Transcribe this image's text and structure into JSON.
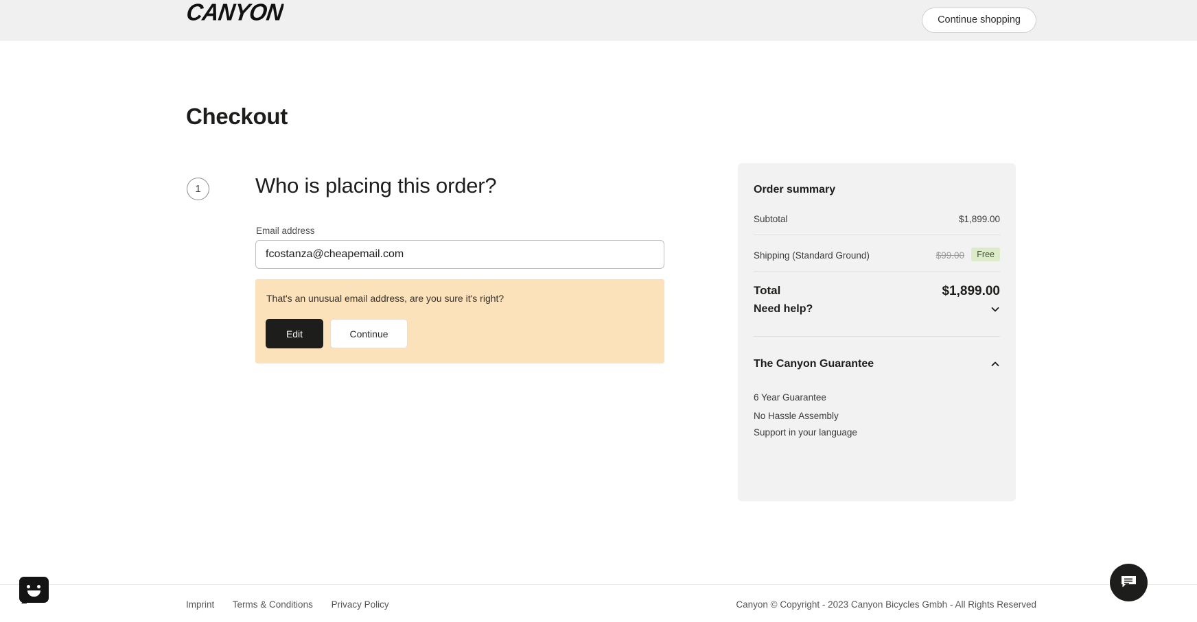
{
  "header": {
    "logo_text": "CANYON",
    "continue_shopping_label": "Continue shopping"
  },
  "page": {
    "title": "Checkout"
  },
  "step": {
    "number": "1",
    "heading": "Who is placing this order?"
  },
  "form": {
    "email_label": "Email address",
    "email_value": "fcostanza@cheapemail.com",
    "email_placeholder": "Email address"
  },
  "warning": {
    "message": "That's an unusual email address, are you sure it's right?",
    "edit_label": "Edit",
    "continue_label": "Continue",
    "background_color": "#fbe2bb"
  },
  "summary": {
    "title": "Order summary",
    "subtotal_label": "Subtotal",
    "subtotal_value": "$1,899.00",
    "shipping_label": "Shipping (Standard Ground)",
    "shipping_original_price": "$99.00",
    "shipping_badge": "Free",
    "badge_color": "#dcecc8",
    "total_label": "Total",
    "total_value": "$1,899.00",
    "need_help_label": "Need help?",
    "guarantee_label": "The Canyon Guarantee",
    "guarantee_items": [
      "6 Year Guarantee",
      "No Hassle Assembly",
      "Support in your language"
    ]
  },
  "footer": {
    "links": [
      "Imprint",
      "Terms & Conditions",
      "Privacy Policy"
    ],
    "copyright": "Canyon © Copyright - 2023 Canyon Bicycles Gmbh - All Rights Reserved"
  },
  "widgets": {
    "feedback_name": "feedback-smiley-widget",
    "chat_name": "chat-widget"
  }
}
